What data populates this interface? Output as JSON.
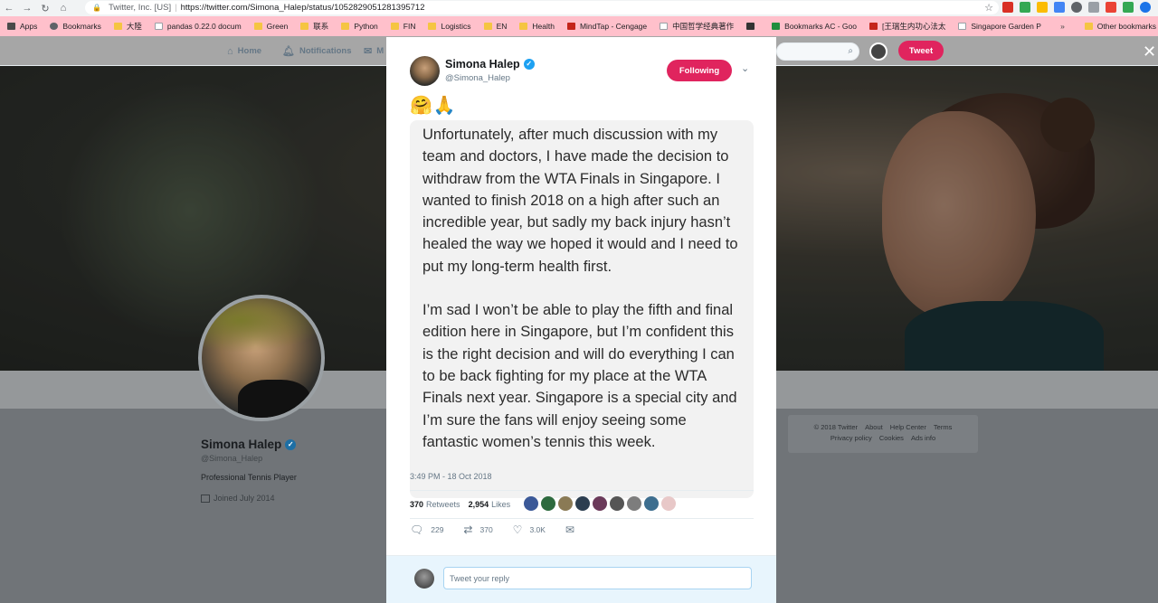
{
  "browser": {
    "site_label": "Twitter, Inc. [US]",
    "url": "https://twitter.com/Simona_Halep/status/1052829051281395712",
    "nav": {
      "back": "←",
      "forward": "→",
      "reload": "↻",
      "home": "⌂"
    },
    "star": "☆",
    "lock": "🔒"
  },
  "bookmarks": {
    "items": [
      {
        "label": "Apps",
        "icon": "apps-grid-icon"
      },
      {
        "label": "Bookmarks",
        "icon": "star-icon"
      },
      {
        "label": "大陸",
        "icon": "folder-icon"
      },
      {
        "label": "pandas 0.22.0 docum",
        "icon": "page-icon"
      },
      {
        "label": "Green",
        "icon": "folder-icon"
      },
      {
        "label": "联系",
        "icon": "folder-icon"
      },
      {
        "label": "Python",
        "icon": "folder-icon"
      },
      {
        "label": "FIN",
        "icon": "folder-icon"
      },
      {
        "label": "Logistics",
        "icon": "folder-icon"
      },
      {
        "label": "EN",
        "icon": "folder-icon"
      },
      {
        "label": "Health",
        "icon": "folder-icon"
      },
      {
        "label": "MindTap - Cengage",
        "icon": "mindtap-icon"
      },
      {
        "label": "中国哲学经典著作",
        "icon": "page-icon"
      },
      {
        "label": "",
        "icon": "s-icon"
      },
      {
        "label": "Bookmarks AC - Goo",
        "icon": "sheets-icon"
      },
      {
        "label": "[王瑞生内功心法太",
        "icon": "youtube-icon"
      },
      {
        "label": "Singapore Garden P",
        "icon": "page-icon"
      }
    ],
    "more": "»",
    "other": "Other bookmarks"
  },
  "twitter_nav": {
    "home": "Home",
    "notifications": "Notifications",
    "messages": "M",
    "tweet_button": "Tweet"
  },
  "profile": {
    "name": "Simona Halep",
    "handle": "@Simona_Halep",
    "bio": "Professional Tennis Player",
    "joined": "Joined July 2014"
  },
  "footer": {
    "links": [
      "© 2018 Twitter",
      "About",
      "Help Center",
      "Terms",
      "Privacy policy",
      "Cookies",
      "Ads info"
    ]
  },
  "tweet": {
    "author_name": "Simona Halep",
    "author_handle": "@Simona_Halep",
    "follow_label": "Following",
    "emoji": "🤗🙏",
    "paragraphs": [
      "Unfortunately, after much discussion with my team and doctors, I have made the decision to withdraw from the WTA Finals in Singapore. I wanted to finish 2018 on a high after such an incredible year, but sadly my back injury hasn’t healed the way we hoped it would and I need to put my long-term health first.",
      "I’m sad I won’t be able to play the fifth and final edition here in Singapore, but I’m confident this is the right decision and will do everything I can to be back fighting for my place at the WTA Finals next year. Singapore is a special city and I’m sure the fans will enjoy seeing some fantastic women’s tennis this week."
    ],
    "timestamp": "3:49 PM - 18 Oct 2018",
    "retweets_count": "370",
    "retweets_label": "Retweets",
    "likes_count": "2,954",
    "likes_label": "Likes",
    "actions": {
      "reply": "229",
      "retweet": "370",
      "like": "3.0K"
    },
    "reply_placeholder": "Tweet your reply",
    "liker_colors": [
      "#3b5998",
      "#2d6a3e",
      "#8a7a55",
      "#2c3e50",
      "#6b3a5a",
      "#555555",
      "#7d7d7d",
      "#3d6e8f",
      "#e8c8c8"
    ]
  }
}
